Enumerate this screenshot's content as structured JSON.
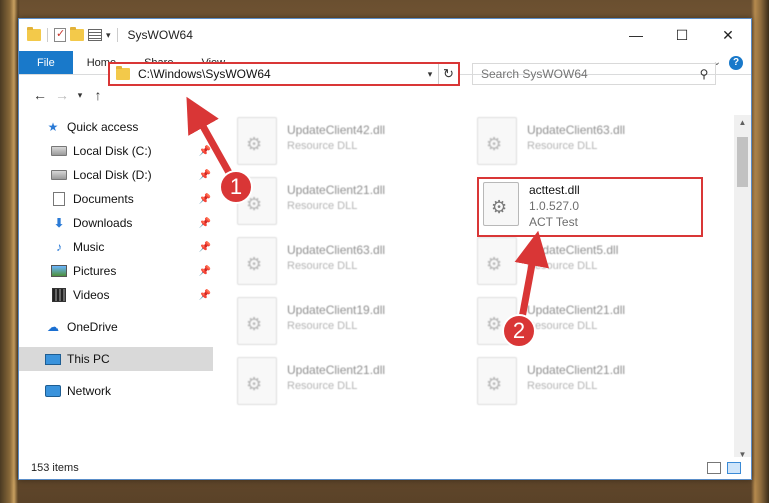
{
  "window": {
    "title": "SysWOW64"
  },
  "ribbon": {
    "tabs": [
      "File",
      "Home",
      "Share",
      "View"
    ]
  },
  "address": {
    "path": "C:\\Windows\\SysWOW64"
  },
  "search": {
    "placeholder": "Search SysWOW64"
  },
  "nav": {
    "items": [
      {
        "label": "Quick access",
        "icon": "star-icon"
      },
      {
        "label": "Local Disk (C:)",
        "icon": "disk-icon",
        "pinned": true
      },
      {
        "label": "Local Disk (D:)",
        "icon": "disk-icon",
        "pinned": true
      },
      {
        "label": "Documents",
        "icon": "document-icon",
        "pinned": true
      },
      {
        "label": "Downloads",
        "icon": "download-icon",
        "pinned": true
      },
      {
        "label": "Music",
        "icon": "music-icon",
        "pinned": true
      },
      {
        "label": "Pictures",
        "icon": "pictures-icon",
        "pinned": true
      },
      {
        "label": "Videos",
        "icon": "videos-icon",
        "pinned": true
      },
      {
        "label": "OneDrive",
        "icon": "cloud-icon"
      },
      {
        "label": "This PC",
        "icon": "computer-icon",
        "selected": true
      },
      {
        "label": "Network",
        "icon": "network-icon"
      }
    ]
  },
  "files": {
    "left": [
      {
        "name": "UpdateClient42.dll",
        "type": "Resource DLL"
      },
      {
        "name": "UpdateClient21.dll",
        "type": "Resource DLL"
      },
      {
        "name": "UpdateClient63.dll",
        "type": "Resource DLL"
      },
      {
        "name": "UpdateClient19.dll",
        "type": "Resource DLL"
      },
      {
        "name": "UpdateClient21.dll",
        "type": "Resource DLL"
      }
    ],
    "right": [
      {
        "name": "UpdateClient63.dll",
        "type": "Resource DLL"
      },
      {
        "name": "UpdateClient5.dll",
        "type": "Resource DLL"
      },
      {
        "name": "UpdateClient21.dll",
        "type": "Resource DLL"
      },
      {
        "name": "UpdateClient21.dll",
        "type": "Resource DLL"
      }
    ],
    "highlighted": {
      "name": "acttest.dll",
      "version": "1.0.527.0",
      "description": "ACT Test"
    }
  },
  "callouts": [
    "1",
    "2"
  ],
  "status": {
    "item_count": "153 items"
  },
  "colors": {
    "accent": "#1979ca",
    "highlight": "#d93636"
  }
}
